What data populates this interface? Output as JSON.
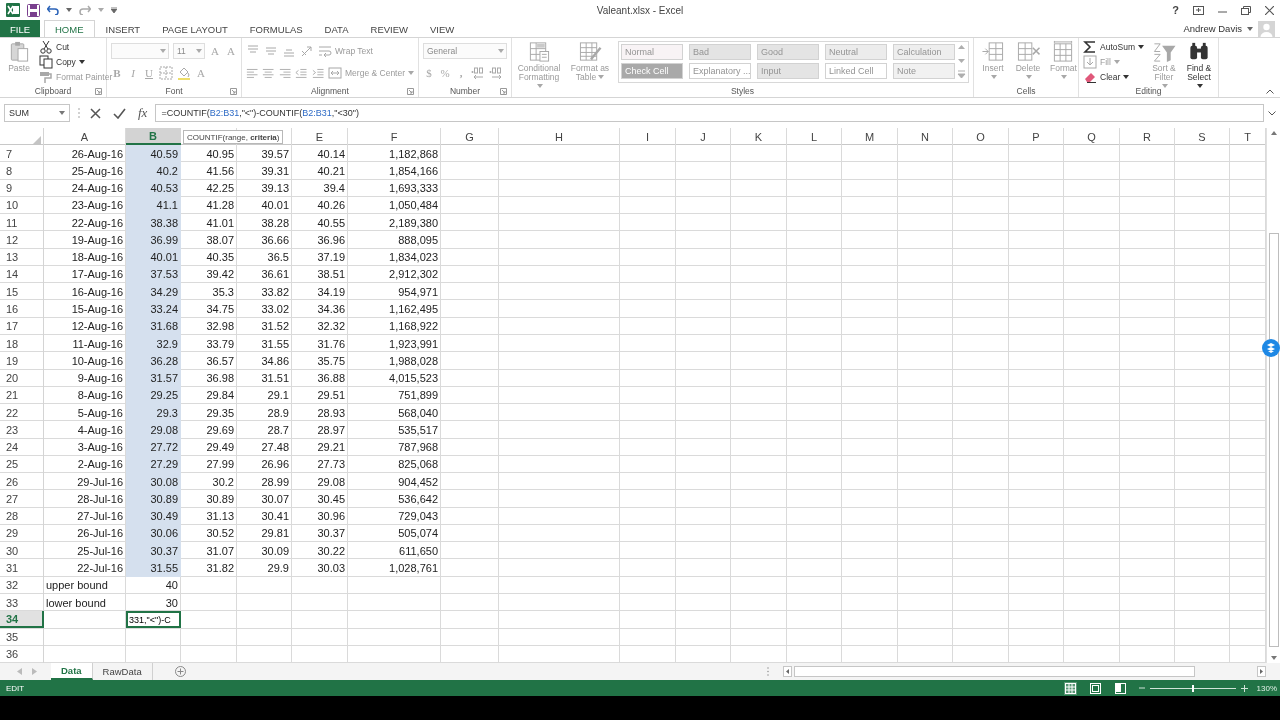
{
  "window": {
    "title": "Valeant.xlsx - Excel",
    "help_label": "?",
    "user": "Andrew Davis"
  },
  "ribbon_tabs": [
    {
      "label": "FILE",
      "kind": "file",
      "selected": false
    },
    {
      "label": "HOME",
      "kind": "tab",
      "selected": true
    },
    {
      "label": "INSERT",
      "kind": "tab",
      "selected": false
    },
    {
      "label": "PAGE LAYOUT",
      "kind": "tab",
      "selected": false
    },
    {
      "label": "FORMULAS",
      "kind": "tab",
      "selected": false
    },
    {
      "label": "DATA",
      "kind": "tab",
      "selected": false
    },
    {
      "label": "REVIEW",
      "kind": "tab",
      "selected": false
    },
    {
      "label": "VIEW",
      "kind": "tab",
      "selected": false
    }
  ],
  "ribbon_groups": [
    {
      "label": "Clipboard",
      "lines": [
        [
          {
            "kind": "large",
            "label": "Paste",
            "disabled": true
          }
        ],
        [
          {
            "kind": "small",
            "label": "Cut",
            "disabled": false
          },
          {
            "kind": "small-menu",
            "label": "Copy",
            "disabled": false
          },
          {
            "kind": "small",
            "label": "Format Painter",
            "disabled": true
          }
        ]
      ]
    },
    {
      "label": "Font",
      "lines": [
        [
          {
            "kind": "combo",
            "disabled": true
          },
          {
            "kind": "spin",
            "text": "11",
            "disabled": true
          },
          {
            "kind": "glyph",
            "text": "A",
            "disabled": true
          },
          {
            "kind": "glyph",
            "text": "A",
            "disabled": true
          }
        ],
        [
          {
            "kind": "glyph",
            "text": "B",
            "disabled": true
          },
          {
            "kind": "glyph",
            "text": "I",
            "disabled": true
          },
          {
            "kind": "glyph",
            "text": "U",
            "disabled": true
          },
          {
            "kind": "icon",
            "disabled": true
          },
          {
            "kind": "icon",
            "disabled": true
          },
          {
            "kind": "glyph",
            "text": "A",
            "disabled": true
          }
        ]
      ]
    },
    {
      "label": "Alignment",
      "lines": [
        [
          {
            "kind": "icon",
            "disabled": true
          },
          {
            "kind": "icon",
            "disabled": true
          },
          {
            "kind": "icon",
            "disabled": true
          },
          {
            "kind": "icon",
            "disabled": true
          },
          {
            "kind": "small",
            "label": "Wrap Text",
            "disabled": true
          }
        ],
        [
          {
            "kind": "icon",
            "disabled": true
          },
          {
            "kind": "icon",
            "disabled": true
          },
          {
            "kind": "icon",
            "disabled": true
          },
          {
            "kind": "icon",
            "disabled": true
          },
          {
            "kind": "icon",
            "disabled": true
          },
          {
            "kind": "small-menu",
            "label": "Merge & Center",
            "disabled": true
          }
        ]
      ]
    },
    {
      "label": "Number",
      "lines": [
        [
          {
            "kind": "combo",
            "text": "General",
            "disabled": true
          }
        ],
        [
          {
            "kind": "glyph",
            "text": "$",
            "disabled": true
          },
          {
            "kind": "glyph",
            "text": "%",
            "disabled": true
          },
          {
            "kind": "glyph",
            "text": ",",
            "disabled": true
          },
          {
            "kind": "icon",
            "disabled": true
          },
          {
            "kind": "icon",
            "disabled": true
          }
        ]
      ]
    },
    {
      "label": "Styles",
      "lines": [
        [
          {
            "kind": "large-menu",
            "label": "Conditional Formatting",
            "disabled": true
          }
        ],
        [
          {
            "kind": "large-menu",
            "label": "Format as Table",
            "disabled": true
          }
        ],
        [
          {
            "kind": "gallery",
            "disabled": true,
            "cells": [
              {
                "label": "Normal",
                "color": "#f8f3f5"
              },
              {
                "label": "Bad",
                "color": "#e3e3e3"
              },
              {
                "label": "Good",
                "color": "#e3e3e3"
              },
              {
                "label": "Neutral",
                "color": "#ececec"
              },
              {
                "label": "Calculation",
                "color": "#eeeeee"
              },
              {
                "label": "Check Cell",
                "color": "#a5a5a5"
              },
              {
                "label": "Explanatory ...",
                "color": "#ffffff"
              },
              {
                "label": "Input",
                "color": "#e3e3e3"
              },
              {
                "label": "Linked Cell",
                "color": "#ffffff"
              },
              {
                "label": "Note",
                "color": "#f1f1f1"
              }
            ]
          }
        ]
      ]
    },
    {
      "label": "Cells",
      "lines": [
        [
          {
            "kind": "large-menu",
            "label": "Insert",
            "disabled": true
          }
        ],
        [
          {
            "kind": "large-menu",
            "label": "Delete",
            "disabled": true
          }
        ],
        [
          {
            "kind": "large-menu",
            "label": "Format",
            "disabled": true
          }
        ]
      ]
    },
    {
      "label": "Editing",
      "lines": [
        [
          {
            "kind": "small-menu",
            "label": "AutoSum",
            "disabled": false
          },
          {
            "kind": "small-menu",
            "label": "Fill",
            "disabled": true
          },
          {
            "kind": "small-menu",
            "label": "Clear",
            "disabled": false
          }
        ],
        [
          {
            "kind": "large-menu",
            "label": "Sort & Filter",
            "disabled": true
          }
        ],
        [
          {
            "kind": "large-menu",
            "label": "Find & Select",
            "disabled": false
          }
        ]
      ]
    }
  ],
  "formula_bar": {
    "name_box": "SUM",
    "function_label": "fx",
    "formula": [
      {
        "text": "=COUNTIF(",
        "kind": "plain"
      },
      {
        "text": "B2:B31",
        "kind": "ref"
      },
      {
        "text": ",\"<\")-COUNTIF(",
        "kind": "plain"
      },
      {
        "text": "B2:B31",
        "kind": "ref"
      },
      {
        "text": ",\"<30\")",
        "kind": "plain"
      }
    ],
    "tooltip": "COUNTIF(range, **criteria**)"
  },
  "grid": {
    "columns": [
      {
        "label": "A",
        "selected": false
      },
      {
        "label": "B",
        "selected": true
      },
      {
        "kind": "covered"
      },
      {
        "kind": "covered"
      },
      {
        "label": "E",
        "selected": false
      },
      {
        "label": "F",
        "selected": false
      },
      {
        "label": "G",
        "selected": false
      },
      {
        "label": "H",
        "selected": false
      },
      {
        "label": "I",
        "selected": false
      },
      {
        "label": "J",
        "selected": false
      },
      {
        "label": "K",
        "selected": false
      },
      {
        "label": "L",
        "selected": false
      },
      {
        "label": "M",
        "selected": false
      },
      {
        "label": "N",
        "selected": false
      },
      {
        "label": "O",
        "selected": false
      },
      {
        "label": "P",
        "selected": false
      },
      {
        "label": "Q",
        "selected": false
      },
      {
        "label": "R",
        "selected": false
      },
      {
        "label": "S",
        "selected": false
      },
      {
        "label": "T",
        "selected": false
      }
    ],
    "rows": [
      {
        "number": "7",
        "kind": "data",
        "selected": false,
        "in_selection": true,
        "cells": [
          "26-Aug-16",
          "40.59",
          "40.95",
          "39.57",
          "40.14",
          "1,182,868"
        ]
      },
      {
        "number": "8",
        "kind": "data",
        "selected": false,
        "in_selection": true,
        "cells": [
          "25-Aug-16",
          "40.2",
          "41.56",
          "39.31",
          "40.21",
          "1,854,166"
        ]
      },
      {
        "number": "9",
        "kind": "data",
        "selected": false,
        "in_selection": true,
        "cells": [
          "24-Aug-16",
          "40.53",
          "42.25",
          "39.13",
          "39.4",
          "1,693,333"
        ]
      },
      {
        "number": "10",
        "kind": "data",
        "selected": false,
        "in_selection": true,
        "cells": [
          "23-Aug-16",
          "41.1",
          "41.28",
          "40.01",
          "40.26",
          "1,050,484"
        ]
      },
      {
        "number": "11",
        "kind": "data",
        "selected": false,
        "in_selection": true,
        "cells": [
          "22-Aug-16",
          "38.38",
          "41.01",
          "38.28",
          "40.55",
          "2,189,380"
        ]
      },
      {
        "number": "12",
        "kind": "data",
        "selected": false,
        "in_selection": true,
        "cells": [
          "19-Aug-16",
          "36.99",
          "38.07",
          "36.66",
          "36.96",
          "888,095"
        ]
      },
      {
        "number": "13",
        "kind": "data",
        "selected": false,
        "in_selection": true,
        "cells": [
          "18-Aug-16",
          "40.01",
          "40.35",
          "36.5",
          "37.19",
          "1,834,023"
        ]
      },
      {
        "number": "14",
        "kind": "data",
        "selected": false,
        "in_selection": true,
        "cells": [
          "17-Aug-16",
          "37.53",
          "39.42",
          "36.61",
          "38.51",
          "2,912,302"
        ]
      },
      {
        "number": "15",
        "kind": "data",
        "selected": false,
        "in_selection": true,
        "cells": [
          "16-Aug-16",
          "34.29",
          "35.3",
          "33.82",
          "34.19",
          "954,971"
        ]
      },
      {
        "number": "16",
        "kind": "data",
        "selected": false,
        "in_selection": true,
        "cells": [
          "15-Aug-16",
          "33.24",
          "34.75",
          "33.02",
          "34.36",
          "1,162,495"
        ]
      },
      {
        "number": "17",
        "kind": "data",
        "selected": false,
        "in_selection": true,
        "cells": [
          "12-Aug-16",
          "31.68",
          "32.98",
          "31.52",
          "32.32",
          "1,168,922"
        ]
      },
      {
        "number": "18",
        "kind": "data",
        "selected": false,
        "in_selection": true,
        "cells": [
          "11-Aug-16",
          "32.9",
          "33.79",
          "31.55",
          "31.76",
          "1,923,991"
        ]
      },
      {
        "number": "19",
        "kind": "data",
        "selected": false,
        "in_selection": true,
        "cells": [
          "10-Aug-16",
          "36.28",
          "36.57",
          "34.86",
          "35.75",
          "1,988,028"
        ]
      },
      {
        "number": "20",
        "kind": "data",
        "selected": false,
        "in_selection": true,
        "cells": [
          "9-Aug-16",
          "31.57",
          "36.98",
          "31.51",
          "36.88",
          "4,015,523"
        ]
      },
      {
        "number": "21",
        "kind": "data",
        "selected": false,
        "in_selection": true,
        "cells": [
          "8-Aug-16",
          "29.25",
          "29.84",
          "29.1",
          "29.51",
          "751,899"
        ]
      },
      {
        "number": "22",
        "kind": "data",
        "selected": false,
        "in_selection": true,
        "cells": [
          "5-Aug-16",
          "29.3",
          "29.35",
          "28.9",
          "28.93",
          "568,040"
        ]
      },
      {
        "number": "23",
        "kind": "data",
        "selected": false,
        "in_selection": true,
        "cells": [
          "4-Aug-16",
          "29.08",
          "29.69",
          "28.7",
          "28.97",
          "535,517"
        ]
      },
      {
        "number": "24",
        "kind": "data",
        "selected": false,
        "in_selection": true,
        "cells": [
          "3-Aug-16",
          "27.72",
          "29.49",
          "27.48",
          "29.21",
          "787,968"
        ]
      },
      {
        "number": "25",
        "kind": "data",
        "selected": false,
        "in_selection": true,
        "cells": [
          "2-Aug-16",
          "27.29",
          "27.99",
          "26.96",
          "27.73",
          "825,068"
        ]
      },
      {
        "number": "26",
        "kind": "data",
        "selected": false,
        "in_selection": true,
        "cells": [
          "29-Jul-16",
          "30.08",
          "30.2",
          "28.99",
          "29.08",
          "904,452"
        ]
      },
      {
        "number": "27",
        "kind": "data",
        "selected": false,
        "in_selection": true,
        "cells": [
          "28-Jul-16",
          "30.89",
          "30.89",
          "30.07",
          "30.45",
          "536,642"
        ]
      },
      {
        "number": "28",
        "kind": "data",
        "selected": false,
        "in_selection": true,
        "cells": [
          "27-Jul-16",
          "30.49",
          "31.13",
          "30.41",
          "30.96",
          "729,043"
        ]
      },
      {
        "number": "29",
        "kind": "data",
        "selected": false,
        "in_selection": true,
        "cells": [
          "26-Jul-16",
          "30.06",
          "30.52",
          "29.81",
          "30.37",
          "505,074"
        ]
      },
      {
        "number": "30",
        "kind": "data",
        "selected": false,
        "in_selection": true,
        "cells": [
          "25-Jul-16",
          "30.37",
          "31.07",
          "30.09",
          "30.22",
          "611,650"
        ]
      },
      {
        "number": "31",
        "kind": "data",
        "selected": false,
        "in_selection": true,
        "cells": [
          "22-Jul-16",
          "31.55",
          "31.82",
          "29.9",
          "30.03",
          "1,028,761"
        ]
      },
      {
        "number": "32",
        "kind": "label",
        "selected": false,
        "in_selection": false,
        "cells": [
          "upper bound",
          "40"
        ]
      },
      {
        "number": "33",
        "kind": "label",
        "selected": false,
        "in_selection": false,
        "cells": [
          "lower bound",
          "30"
        ]
      },
      {
        "number": "34",
        "kind": "edit",
        "selected": true,
        "in_selection": false,
        "cells": [
          "331,\"<\")-C"
        ]
      },
      {
        "number": "35",
        "kind": "empty",
        "selected": false,
        "in_selection": false
      },
      {
        "number": "36",
        "kind": "empty",
        "selected": false,
        "in_selection": false
      }
    ]
  },
  "sheet_tabs": [
    {
      "label": "Data",
      "selected": true
    },
    {
      "label": "RawData",
      "selected": false
    }
  ],
  "status_bar": {
    "mode": "EDIT",
    "views": [
      {
        "selected": true
      },
      {
        "selected": false
      },
      {
        "selected": false
      }
    ],
    "zoom": {
      "level": 0.5,
      "reading": "130%"
    }
  }
}
